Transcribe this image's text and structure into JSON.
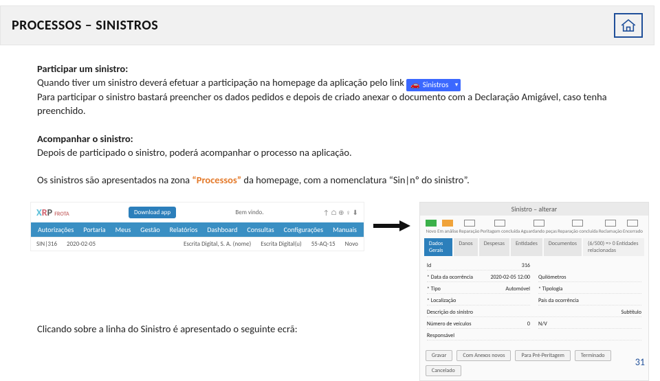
{
  "header": {
    "title": "PROCESSOS – SINISTROS"
  },
  "section1": {
    "heading": "Participar um sinistro:",
    "line1a": "Quando tiver um sinistro deverá efetuar a participação na homepage da aplicação pelo link",
    "btn_label": "Sinistros",
    "line2": "Para participar o sinistro bastará preencher os dados pedidos e depois de criado anexar o documento com a Declaração Amigável, caso tenha preenchido."
  },
  "section2": {
    "heading": "Acompanhar o sinistro:",
    "line1": "Depois de participado o sinistro, poderá acompanhar o processo na aplicação."
  },
  "section3": {
    "pre": "Os sinistros são apresentados na zona ",
    "highlight": "“Processos”",
    "post": " da homepage, com a nomenclatura “Sin|nº do sinistro”."
  },
  "shot_left": {
    "logo": "XRP",
    "logo_sub": "FROTA",
    "download": "Download app",
    "welcome": "Bem vindo.",
    "menu": [
      "Autorizações",
      "Portaria",
      "Meus",
      "Gestão",
      "Relatórios",
      "Dashboard",
      "Consultas",
      "Configurações",
      "Manuais"
    ],
    "row": {
      "c1": "SIN|316",
      "c2": "2020-02-05",
      "c3": "Escrita Digital, S. A. (nome)",
      "c4": "Escrita Digital(u)",
      "c5": "55-AQ-15",
      "c6": "Novo"
    }
  },
  "shot_right": {
    "title": "Sinistro – alterar",
    "steps": [
      "Novo",
      "Em análise",
      "Reparação",
      "Peritagem concluída",
      "Aguardando peças",
      "Reparação concluída",
      "Reclamação",
      "Encerrado"
    ],
    "tabs": [
      "Dados Gerais",
      "Danos",
      "Despesas",
      "Entidades",
      "Documentos"
    ],
    "tab_note": "(6/500) => 0 Entidades relacionadas",
    "form": {
      "id_l": "Id",
      "id_v": "316",
      "data_l": "* Data da ocorrência",
      "data_v": "2020-02-05 12:00",
      "km_l": "Quilómetros",
      "km_v": "",
      "tipo_l": "* Tipo",
      "tipo_v": "Automóvel",
      "tip_l": "* Tipologia",
      "tip_v": "",
      "loc_l": "* Localização",
      "loc_v": "",
      "pais_l": "País da ocorrência",
      "pais_v": "",
      "desc_l": "Descrição do sinistro",
      "desc_v": "Subtítulo",
      "nve_l": "Número de veículos",
      "nve_v": "0",
      "nv_l": "N/V",
      "nv_v": "",
      "resp_l": "Responsável",
      "resp_v": ""
    },
    "buttons": [
      "Gravar",
      "Com Anexos novos",
      "Para Pré-Peritagem",
      "Terminado",
      "Cancelado"
    ]
  },
  "footer_line": "Clicando sobre a linha do Sinistro é apresentado o seguinte ecrã:",
  "page_number": "31"
}
